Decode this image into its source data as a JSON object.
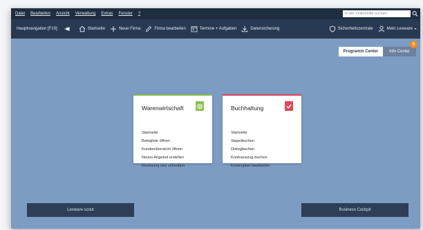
{
  "menubar": {
    "items": [
      "Datei",
      "Bearbeiten",
      "Ansicht",
      "Verwaltung",
      "Extras",
      "Fenster",
      "?"
    ],
    "search_placeholder": "In der Onlinehilfe suchen"
  },
  "toolbar": {
    "main_nav": "Hauptnavigation [F10]",
    "startseite": "Startseite",
    "neue_firma": "Neue Firma",
    "firma_bearbeiten": "Firma bearbeiten",
    "termine": "Termine + Aufgaben",
    "datensicherung": "Datensicherung",
    "sicherheitszentrale": "Sicherheitszentrale",
    "mein_lexware": "Mein Lexware"
  },
  "tabs": {
    "programm_center": "Programm Center",
    "info_center": "Info Center",
    "info_badge": "5"
  },
  "cards": {
    "warenwirtschaft": {
      "title": "Warenwirtschaft",
      "accent": "#8cc152",
      "links": [
        "Startseite",
        "Belegliste öffnen",
        "Kundenübersicht öffnen",
        "Neues Angebot erstellen",
        "Rechnung neu schreiben"
      ]
    },
    "buchhaltung": {
      "title": "Buchhaltung",
      "accent": "#e0475a",
      "links": [
        "Startseite",
        "Stapelbuchen",
        "Dialogbuchen",
        "Kontoauszug buchen",
        "Kontenplan bearbeiten"
      ]
    }
  },
  "bottom": {
    "scout": "Lexware scout",
    "cockpit": "Business Cockpit"
  },
  "icons": [
    "search-icon",
    "pin-icon",
    "home-icon",
    "plus-icon",
    "pencil-icon",
    "calendar-icon",
    "download-icon",
    "shield-icon",
    "user-icon",
    "chevron-down-icon",
    "box-icon",
    "checkmark-icon"
  ]
}
